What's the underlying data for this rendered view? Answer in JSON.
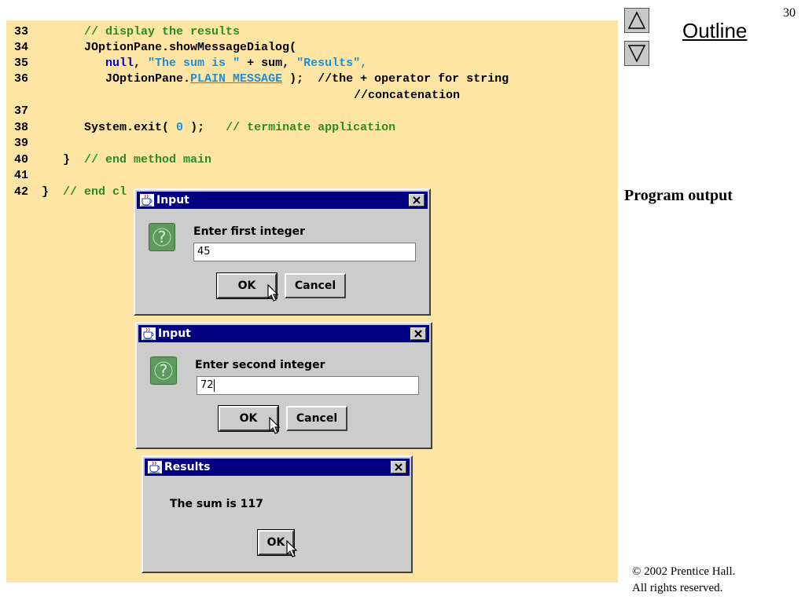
{
  "slide": {
    "page_number": "30",
    "outline_label": "Outline",
    "side_label": "Program output",
    "copyright_line1": "© 2002 Prentice Hall.",
    "copyright_line2": "All rights reserved."
  },
  "code": {
    "l33": {
      "num": "33",
      "c1": "// display the results"
    },
    "l34": {
      "num": "34",
      "t1": "JOptionPane.showMessageDialog("
    },
    "l35": {
      "num": "35",
      "k1": "null",
      "t1": ", ",
      "s1": "\"The sum is \"",
      "t2": " + sum, ",
      "s2": "\"Results\"",
      "t3": ","
    },
    "l36": {
      "num": "36",
      "t1": "JOptionPane.",
      "k1": "PLAIN_MESSAGE",
      "t2": " );  //the + operator for string"
    },
    "l36b": {
      "t1": "//concatenation"
    },
    "l37": {
      "num": "37"
    },
    "l38": {
      "num": "38",
      "t1": "System.exit( ",
      "n1": "0",
      "t2": " );   ",
      "c1": "// terminate application"
    },
    "l39": {
      "num": "39"
    },
    "l40": {
      "num": "40",
      "t1": "}  ",
      "c1": "// end method main"
    },
    "l41": {
      "num": "41"
    },
    "l42": {
      "num": "42",
      "t1": "}  ",
      "c1": "// end cl"
    }
  },
  "dialogs": {
    "first": {
      "title": "Input",
      "prompt": "Enter first integer",
      "value": "45",
      "ok": "OK",
      "cancel": "Cancel"
    },
    "second": {
      "title": "Input",
      "prompt": "Enter second integer",
      "value": "72",
      "ok": "OK",
      "cancel": "Cancel"
    },
    "result": {
      "title": "Results",
      "message": "The sum is 117",
      "ok": "OK"
    }
  },
  "icons": {
    "nav_up": "triangle-up-icon",
    "nav_down": "triangle-down-icon",
    "question": "question-icon",
    "java_cup": "java-cup-icon",
    "close": "close-icon",
    "cursor": "mouse-cursor-icon"
  },
  "colors": {
    "code_background": "#ffe5a3",
    "keyword": "#0000cc",
    "string": "#1d8fd8",
    "comment": "#2a8a2a",
    "titlebar": "#000080",
    "dialog_bg": "#cccccc"
  }
}
